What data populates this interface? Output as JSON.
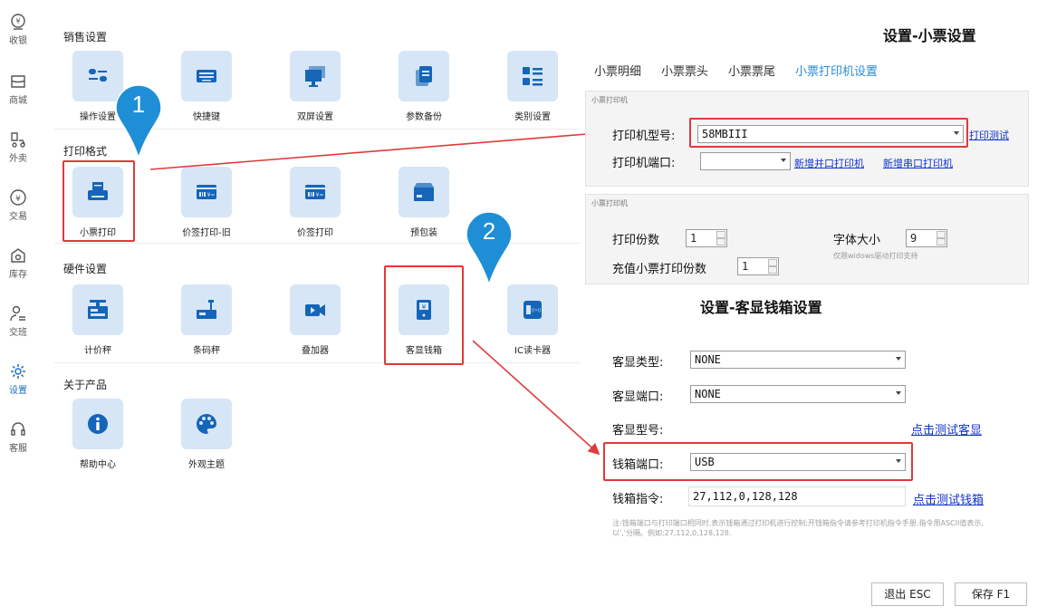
{
  "rail": [
    {
      "label": "收银",
      "icon": "cashier-icon"
    },
    {
      "label": "商城",
      "icon": "mall-icon"
    },
    {
      "label": "外卖",
      "icon": "delivery-icon"
    },
    {
      "label": "交易",
      "icon": "trade-icon"
    },
    {
      "label": "库存",
      "icon": "inventory-icon"
    },
    {
      "label": "交班",
      "icon": "shift-icon"
    },
    {
      "label": "设置",
      "icon": "settings-icon",
      "active": true
    },
    {
      "label": "客服",
      "icon": "support-icon"
    }
  ],
  "sections": {
    "sales": "销售设置",
    "print": "打印格式",
    "hardware": "硬件设置",
    "about": "关于产品"
  },
  "tiles": {
    "sales": [
      "操作设置",
      "快捷键",
      "双屏设置",
      "参数备份",
      "类别设置"
    ],
    "print": [
      "小票打印",
      "价签打印-旧",
      "价签打印",
      "预包装"
    ],
    "hardware": [
      "计价秤",
      "条码秤",
      "叠加器",
      "客显钱箱",
      "IC读卡器"
    ],
    "about": [
      "帮助中心",
      "外观主题"
    ]
  },
  "pins": [
    "1",
    "2"
  ],
  "ticket": {
    "title": "设置-小票设置",
    "tabs": [
      "小票明细",
      "小票票头",
      "小票票尾",
      "小票打印机设置"
    ],
    "active_tab": 3,
    "panel1_title": "小票打印机",
    "printer_model_label": "打印机型号:",
    "printer_model_value": "58MBIII",
    "print_test": "打印测试",
    "printer_port_label": "打印机端口:",
    "printer_port_value": "",
    "add_parallel": "新增并口打印机",
    "add_serial": "新增串口打印机",
    "panel2_title": "小票打印机",
    "copies_label": "打印份数",
    "copies_value": "1",
    "font_size_label": "字体大小",
    "font_size_value": "9",
    "font_note": "仅限widows驱动打印支持",
    "recharge_copies_label": "充值小票打印份数",
    "recharge_copies_value": "1"
  },
  "drawer": {
    "title": "设置-客显钱箱设置",
    "display_type_label": "客显类型:",
    "display_type_value": "NONE",
    "display_port_label": "客显端口:",
    "display_port_value": "NONE",
    "display_model_label": "客显型号:",
    "test_display": "点击测试客显",
    "drawer_port_label": "钱箱端口:",
    "drawer_port_value": "USB",
    "drawer_cmd_label": "钱箱指令:",
    "drawer_cmd_value": "27,112,0,128,128",
    "test_drawer": "点击测试钱箱",
    "note": "注:钱箱端口与打印端口相同时,表示钱箱通过打印机进行控制;开钱箱指令请参考打印机指令手册,指令用ASCII值表示,以','分隔。例如:27,112,0,128,128."
  },
  "footer": {
    "exit": "退出 ESC",
    "save": "保存 F1"
  },
  "colors": {
    "accent": "#2a8bd6",
    "tile_bg": "#d6e6f6",
    "icon": "#1565b8",
    "highlight": "#e03a3a",
    "pin": "#1e8fd6"
  }
}
